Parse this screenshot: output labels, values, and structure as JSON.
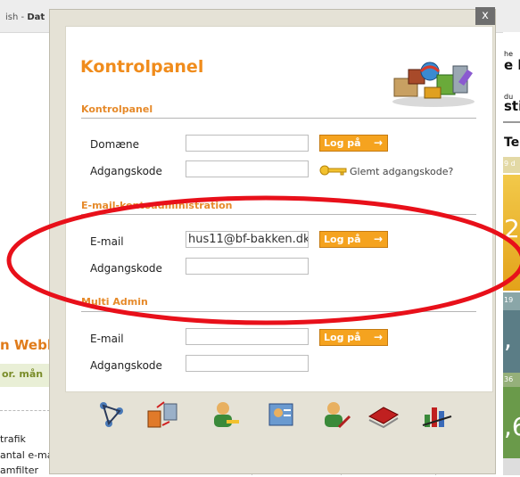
{
  "background": {
    "breadcrumb_prefix": "ish -",
    "breadcrumb_bold": "Dat",
    "left_title": "n Webl",
    "left_band": "or. mån",
    "rows": [
      "trafik",
      "antal e-mail-konti",
      "amfilter"
    ],
    "right": {
      "t1": "he",
      "t2": "e l",
      "t3": "du",
      "t4": "sti",
      "t5": "Te",
      "t6": "9 d",
      "t7": "2",
      "t8": "19",
      "t9": ",",
      "t10": "36",
      "t11": ",6"
    }
  },
  "modal": {
    "close_label": "x",
    "title": "Kontrolpanel",
    "sections": {
      "kontrol": {
        "heading": "Kontrolpanel",
        "domain_label": "Domæne",
        "domain_value": "",
        "password_label": "Adgangskode",
        "login_label": "Log på",
        "forgot_label": "Glemt adgangskode?"
      },
      "email_admin": {
        "heading": "E-mail-kontoadministration",
        "email_label": "E-mail",
        "email_value": "hus11@bf-bakken.dk",
        "password_label": "Adgangskode",
        "login_label": "Log på"
      },
      "multi": {
        "heading": "Multi Admin",
        "email_label": "E-mail",
        "email_value": "",
        "password_label": "Adgangskode",
        "login_label": "Log på"
      }
    },
    "bottom_icons": [
      "network-icon",
      "server-transfer-icon",
      "user-key-icon",
      "user-card-icon",
      "user-edit-icon",
      "book-icon",
      "chart-icon"
    ]
  },
  "colors": {
    "accent_orange": "#f08c1c",
    "button_orange": "#f5a31f",
    "highlight_red": "#e8101a",
    "check_green": "#3c9a1a"
  }
}
